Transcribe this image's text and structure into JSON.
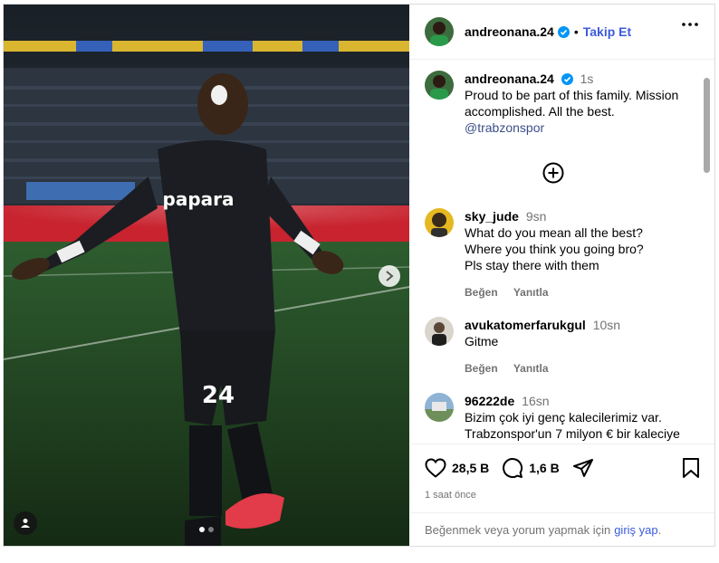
{
  "post": {
    "photo_alt": "",
    "carousel_dots": 2,
    "active_dot": 0
  },
  "header": {
    "username": "andreonana.24",
    "separator": "•",
    "follow_label": "Takip Et"
  },
  "caption": {
    "username": "andreonana.24",
    "time": "1s",
    "text": "Proud to be part of this family. Mission accomplished. All the best.",
    "mention": "@trabzonspor"
  },
  "comments": [
    {
      "username": "sky_jude",
      "time": "9sn",
      "lines": [
        "What do you mean all the best?",
        "Where you think you going bro?",
        "Pls stay there with them"
      ],
      "like_label": "Beğen",
      "reply_label": "Yanıtla"
    },
    {
      "username": "avukatomerfarukgul",
      "time": "10sn",
      "lines": [
        "Gitme"
      ],
      "like_label": "Beğen",
      "reply_label": "Yanıtla"
    },
    {
      "username": "96222de",
      "time": "16sn",
      "lines": [
        "Bizim çok iyi genç kalecilerimiz var.",
        "Trabzonspor'un 7 milyon € bir kaleciye"
      ],
      "like_label": "",
      "reply_label": ""
    }
  ],
  "stats": {
    "likes": "28,5 B",
    "comments": "1,6 B",
    "time_ago": "1 saat önce"
  },
  "login_prompt": {
    "text": "Beğenmek veya yorum yapmak için",
    "link": "giriş yap",
    "suffix": "."
  },
  "colors": {
    "accent": "#3b5bdb",
    "verified": "#0095f6",
    "muted": "#737373",
    "jersey": "#1b1d22",
    "boots": "#e23b4a"
  },
  "icons": [
    "verified-icon",
    "more-icon",
    "add-comment-icon",
    "heart-icon",
    "comment-icon",
    "share-icon",
    "bookmark-icon",
    "chevron-right-icon",
    "user-tag-icon"
  ],
  "jersey": {
    "sponsor": "papara",
    "number": "24"
  }
}
